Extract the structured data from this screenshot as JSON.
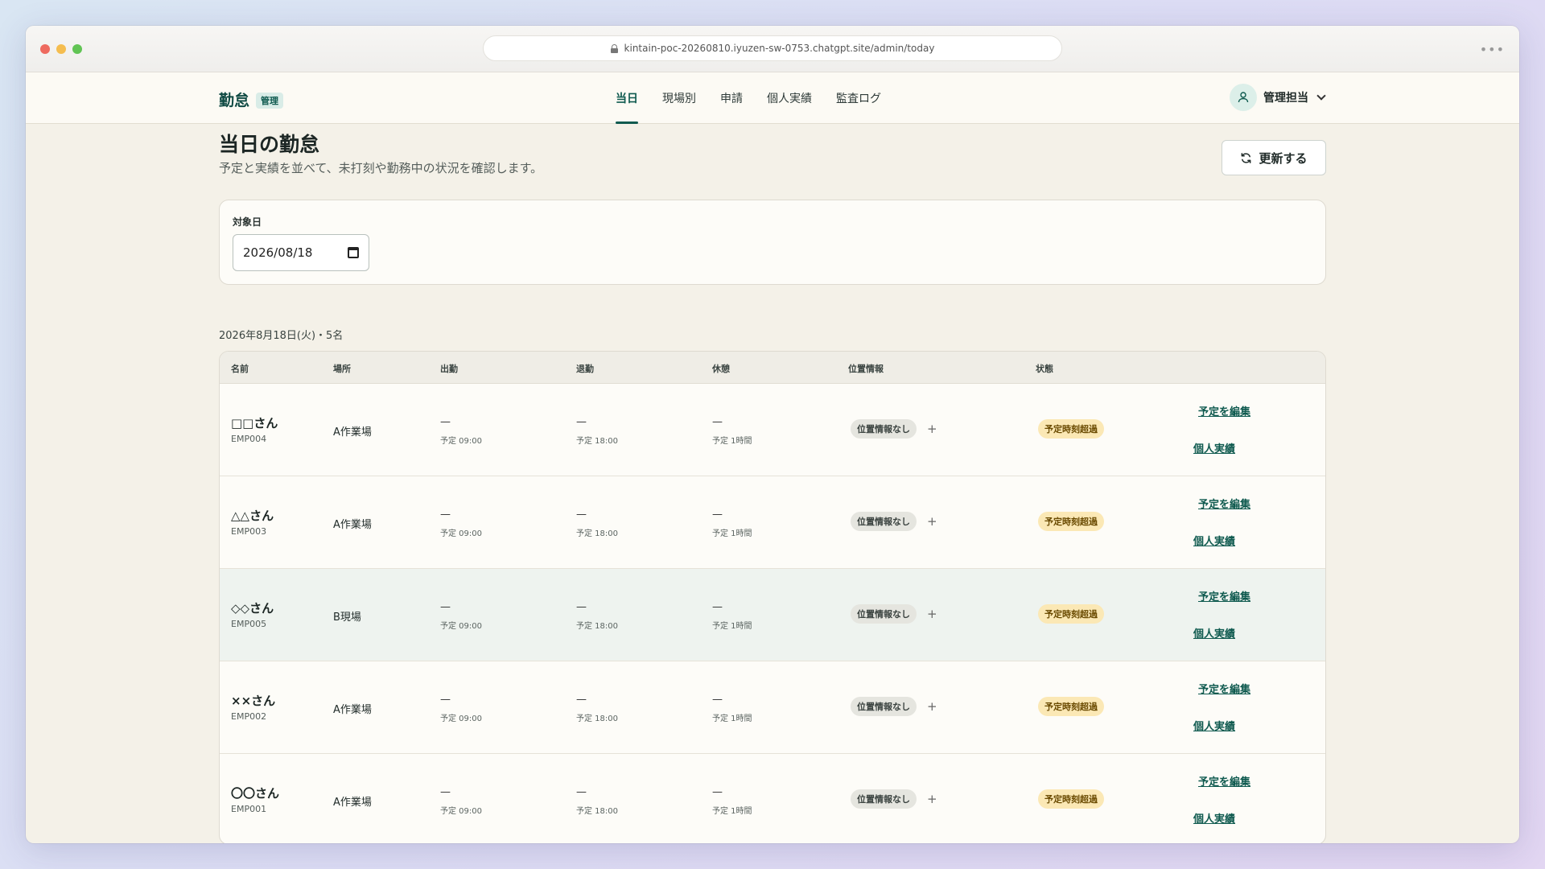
{
  "browser": {
    "url": "kintain-poc-20260810.iyuzen-sw-0753.chatgpt.site/admin/today"
  },
  "header": {
    "brand": "勤怠",
    "badge": "管理",
    "tabs": [
      {
        "label": "当日",
        "active": true
      },
      {
        "label": "現場別"
      },
      {
        "label": "申請"
      },
      {
        "label": "個人実績"
      },
      {
        "label": "監査ログ"
      }
    ],
    "user_name": "管理担当"
  },
  "page": {
    "title": "当日の勤怠",
    "subtitle": "予定と実績を並べて、未打刻や勤務中の状況を確認します。",
    "refresh_label": "更新する"
  },
  "filter": {
    "label": "対象日",
    "date_value": "2026/08/18"
  },
  "summary": "2026年8月18日(火)・5名",
  "table": {
    "headers": {
      "name": "名前",
      "site": "場所",
      "in": "出勤",
      "out": "退勤",
      "break": "休憩",
      "location": "位置情報",
      "status": "状態"
    },
    "rows": [
      {
        "name": "□□さん",
        "code": "EMP004",
        "site": "A作業場",
        "in": "—",
        "in_plan": "予定 09:00",
        "out": "—",
        "out_plan": "予定 18:00",
        "break": "—",
        "break_plan": "予定 1時間",
        "location": "位置情報なし",
        "status": "予定時刻超過",
        "edit": "予定を編集",
        "personal": "個人実績"
      },
      {
        "name": "△△さん",
        "code": "EMP003",
        "site": "A作業場",
        "in": "—",
        "in_plan": "予定 09:00",
        "out": "—",
        "out_plan": "予定 18:00",
        "break": "—",
        "break_plan": "予定 1時間",
        "location": "位置情報なし",
        "status": "予定時刻超過",
        "edit": "予定を編集",
        "personal": "個人実績"
      },
      {
        "name": "◇◇さん",
        "code": "EMP005",
        "site": "B現場",
        "in": "—",
        "in_plan": "予定 09:00",
        "out": "—",
        "out_plan": "予定 18:00",
        "break": "—",
        "break_plan": "予定 1時間",
        "location": "位置情報なし",
        "status": "予定時刻超過",
        "edit": "予定を編集",
        "personal": "個人実績"
      },
      {
        "name": "××さん",
        "code": "EMP002",
        "site": "A作業場",
        "in": "—",
        "in_plan": "予定 09:00",
        "out": "—",
        "out_plan": "予定 18:00",
        "break": "—",
        "break_plan": "予定 1時間",
        "location": "位置情報なし",
        "status": "予定時刻超過",
        "edit": "予定を編集",
        "personal": "個人実績"
      },
      {
        "name": "〇〇さん",
        "code": "EMP001",
        "site": "A作業場",
        "in": "—",
        "in_plan": "予定 09:00",
        "out": "—",
        "out_plan": "予定 18:00",
        "break": "—",
        "break_plan": "予定 1時間",
        "location": "位置情報なし",
        "status": "予定時刻超過",
        "edit": "予定を編集",
        "personal": "個人実績"
      }
    ]
  }
}
